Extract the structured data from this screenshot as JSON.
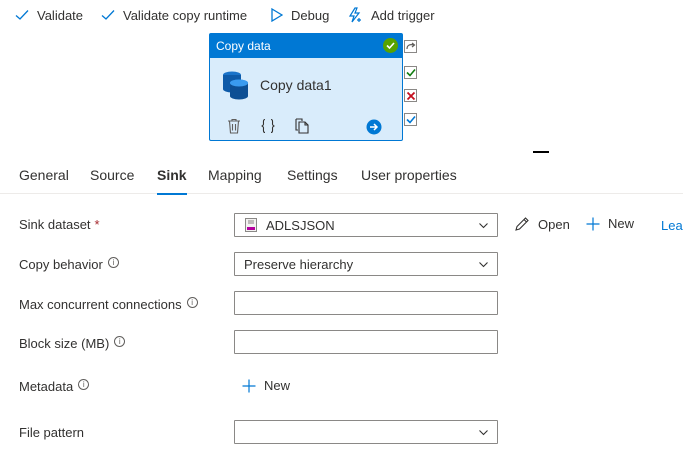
{
  "toolbar": {
    "validate": "Validate",
    "validate_copy_runtime": "Validate copy runtime",
    "debug": "Debug",
    "add_trigger": "Add trigger"
  },
  "activity": {
    "type_label": "Copy data",
    "name": "Copy data1"
  },
  "tabs": [
    "General",
    "Source",
    "Sink",
    "Mapping",
    "Settings",
    "User properties"
  ],
  "active_tab": "Sink",
  "form": {
    "sink_dataset": {
      "label": "Sink dataset",
      "required_mark": "*",
      "value": "ADLSJSON",
      "open": "Open",
      "new": "New",
      "learn": "Learn more"
    },
    "copy_behavior": {
      "label": "Copy behavior",
      "value": "Preserve hierarchy"
    },
    "max_connections": {
      "label": "Max concurrent connections",
      "value": ""
    },
    "block_size": {
      "label": "Block size (MB)",
      "value": ""
    },
    "metadata": {
      "label": "Metadata",
      "new": "New"
    },
    "file_pattern": {
      "label": "File pattern",
      "value": ""
    }
  },
  "colors": {
    "accent": "#0078d4",
    "success": "#57a300",
    "error": "#a4262c"
  }
}
